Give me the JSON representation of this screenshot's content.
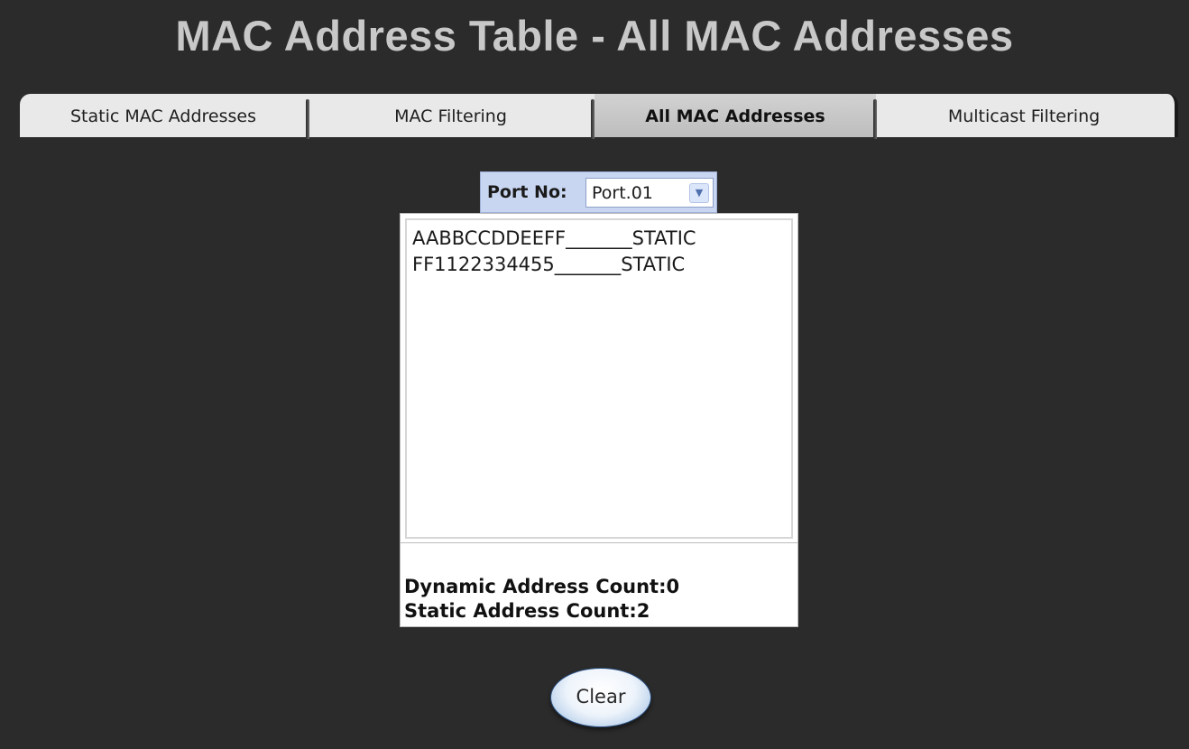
{
  "page_title": "MAC Address Table - All MAC Addresses",
  "tabs": [
    {
      "label": "Static MAC Addresses",
      "active": false
    },
    {
      "label": "MAC Filtering",
      "active": false
    },
    {
      "label": "All MAC Addresses",
      "active": true
    },
    {
      "label": "Multicast Filtering",
      "active": false
    }
  ],
  "port_selector": {
    "label": "Port No:",
    "selected": "Port.01",
    "arrow_icon": "chevron-down-icon"
  },
  "mac_entries": [
    {
      "text": "AABBCCDDEEFF_______STATIC"
    },
    {
      "text": "FF1122334455_______STATIC"
    }
  ],
  "counts": {
    "dynamic": "Dynamic Address Count:0",
    "static": "Static Address Count:2"
  },
  "clear_button": {
    "label": "Clear"
  },
  "colors": {
    "background": "#2b2b2b",
    "title": "#c8c8c8",
    "tab_bg": "#e9e9e9",
    "tab_active_bg": "#c6c6c6",
    "port_box_bg": "#c9d6f1",
    "button_accent": "#2c5d97"
  }
}
